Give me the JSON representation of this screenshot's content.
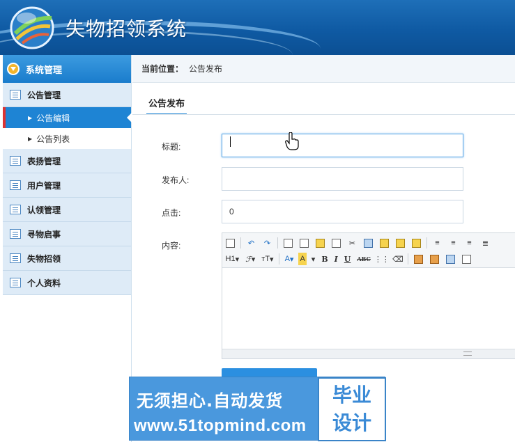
{
  "header": {
    "title": "失物招领系统"
  },
  "sidebar": {
    "top_label": "系统管理",
    "groups": [
      {
        "label": "公告管理"
      },
      {
        "label": "表扬管理"
      },
      {
        "label": "用户管理"
      },
      {
        "label": "认领管理"
      },
      {
        "label": "寻物启事"
      },
      {
        "label": "失物招领"
      },
      {
        "label": "个人资料"
      }
    ],
    "sub_items": [
      {
        "label": "公告编辑",
        "active": true
      },
      {
        "label": "公告列表",
        "active": false
      }
    ]
  },
  "breadcrumb": {
    "label": "当前位置：",
    "value": "公告发布"
  },
  "tab": {
    "label": "公告发布"
  },
  "form": {
    "title_label": "标题:",
    "title_value": "",
    "publisher_label": "发布人:",
    "publisher_value": "",
    "clicks_label": "点击:",
    "clicks_value": "0",
    "content_label": "内容:"
  },
  "editor": {
    "heading_btn": "H1",
    "font_btn": "ℱ",
    "size_btn": "тT",
    "font_color_btn": "A",
    "bg_color_btn": "A",
    "bold_btn": "B",
    "italic_btn": "I",
    "underline_btn": "U",
    "strike_btn": "ABC"
  },
  "banner": {
    "line1": "无须担心.自动发货",
    "line2": "www.51topmind.com",
    "box_line1": "毕业",
    "box_line2": "设计"
  },
  "colors": {
    "accent": "#1e84d4",
    "header": "#0f5aa3"
  }
}
